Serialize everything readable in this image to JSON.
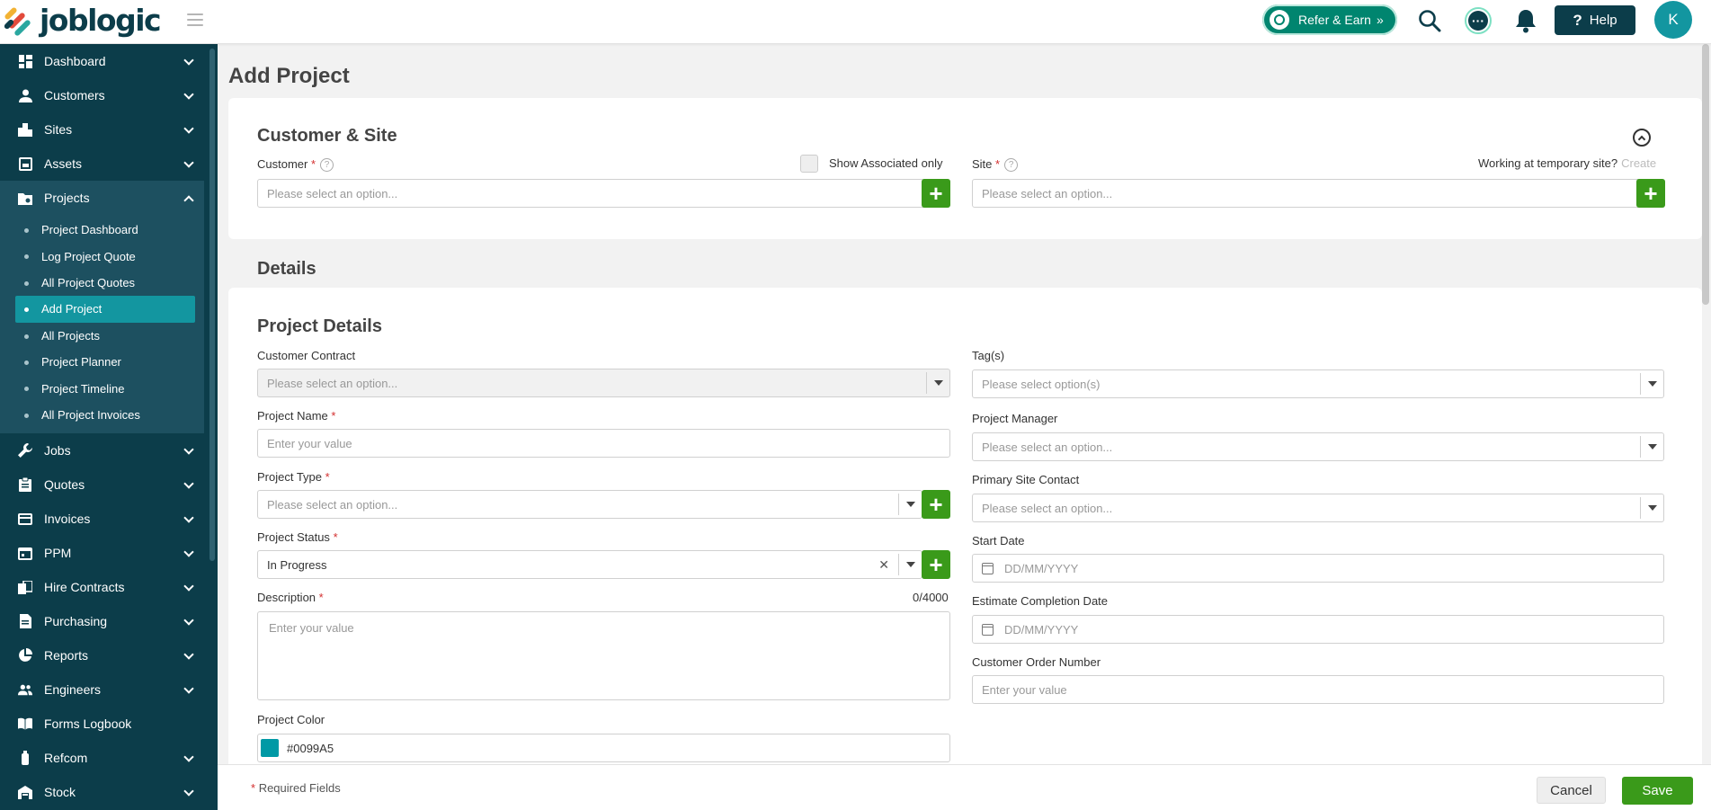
{
  "app": {
    "logo_text": "joblogic"
  },
  "topbar": {
    "refer_label": "Refer & Earn",
    "refer_arrow": "»",
    "help_label": "Help",
    "help_symbol": "?",
    "avatar_initial": "K"
  },
  "sidebar": {
    "items": [
      {
        "label": "Dashboard",
        "icon": "dashboard-icon"
      },
      {
        "label": "Customers",
        "icon": "user-icon"
      },
      {
        "label": "Sites",
        "icon": "building-icon"
      },
      {
        "label": "Assets",
        "icon": "asset-icon"
      },
      {
        "label": "Projects",
        "icon": "projects-icon"
      },
      {
        "label": "Jobs",
        "icon": "wrench-icon"
      },
      {
        "label": "Quotes",
        "icon": "clipboard-icon"
      },
      {
        "label": "Invoices",
        "icon": "invoice-icon"
      },
      {
        "label": "PPM",
        "icon": "ppm-icon"
      },
      {
        "label": "Hire Contracts",
        "icon": "hire-icon"
      },
      {
        "label": "Purchasing",
        "icon": "purchasing-icon"
      },
      {
        "label": "Reports",
        "icon": "pie-chart-icon"
      },
      {
        "label": "Engineers",
        "icon": "engineers-icon"
      },
      {
        "label": "Forms Logbook",
        "icon": "book-icon"
      },
      {
        "label": "Refcom",
        "icon": "refcom-icon"
      },
      {
        "label": "Stock",
        "icon": "stock-icon"
      }
    ],
    "projects_sub": [
      "Project Dashboard",
      "Log Project Quote",
      "All Project Quotes",
      "Add Project",
      "All Projects",
      "Project Planner",
      "Project Timeline",
      "All Project Invoices"
    ]
  },
  "page": {
    "title": "Add Project",
    "customer_site": {
      "title": "Customer & Site",
      "customer_label": "Customer",
      "customer_placeholder": "Please select an option...",
      "show_associated_label": "Show Associated only",
      "site_label": "Site",
      "site_placeholder": "Please select an option...",
      "temp_site_text": "Working at temporary site?",
      "create_link": "Create"
    },
    "details_title": "Details",
    "project_details": {
      "title": "Project Details",
      "customer_contract_label": "Customer Contract",
      "customer_contract_placeholder": "Please select an option...",
      "project_name_label": "Project Name",
      "project_name_placeholder": "Enter your value",
      "project_type_label": "Project Type",
      "project_type_placeholder": "Please select an option...",
      "project_status_label": "Project Status",
      "project_status_value": "In Progress",
      "description_label": "Description",
      "description_counter": "0/4000",
      "description_placeholder": "Enter your value",
      "project_color_label": "Project Color",
      "project_color_value": "#0099A5",
      "tags_label": "Tag(s)",
      "tags_placeholder": "Please select option(s)",
      "project_manager_label": "Project Manager",
      "project_manager_placeholder": "Please select an option...",
      "primary_site_contact_label": "Primary Site Contact",
      "primary_site_contact_placeholder": "Please select an option...",
      "start_date_label": "Start Date",
      "start_date_placeholder": "DD/MM/YYYY",
      "estimate_completion_label": "Estimate Completion Date",
      "estimate_completion_placeholder": "DD/MM/YYYY",
      "customer_order_label": "Customer Order Number",
      "customer_order_placeholder": "Enter your value"
    }
  },
  "footer": {
    "required_marker": "*",
    "required_text": "Required Fields",
    "cancel_label": "Cancel",
    "save_label": "Save"
  },
  "colors": {
    "sidebar_bg": "#0c3d4a",
    "accent_teal": "#1396a0",
    "save_green": "#3a9a1a",
    "required_red": "#d32f2f",
    "project_color": "#0099A5"
  }
}
